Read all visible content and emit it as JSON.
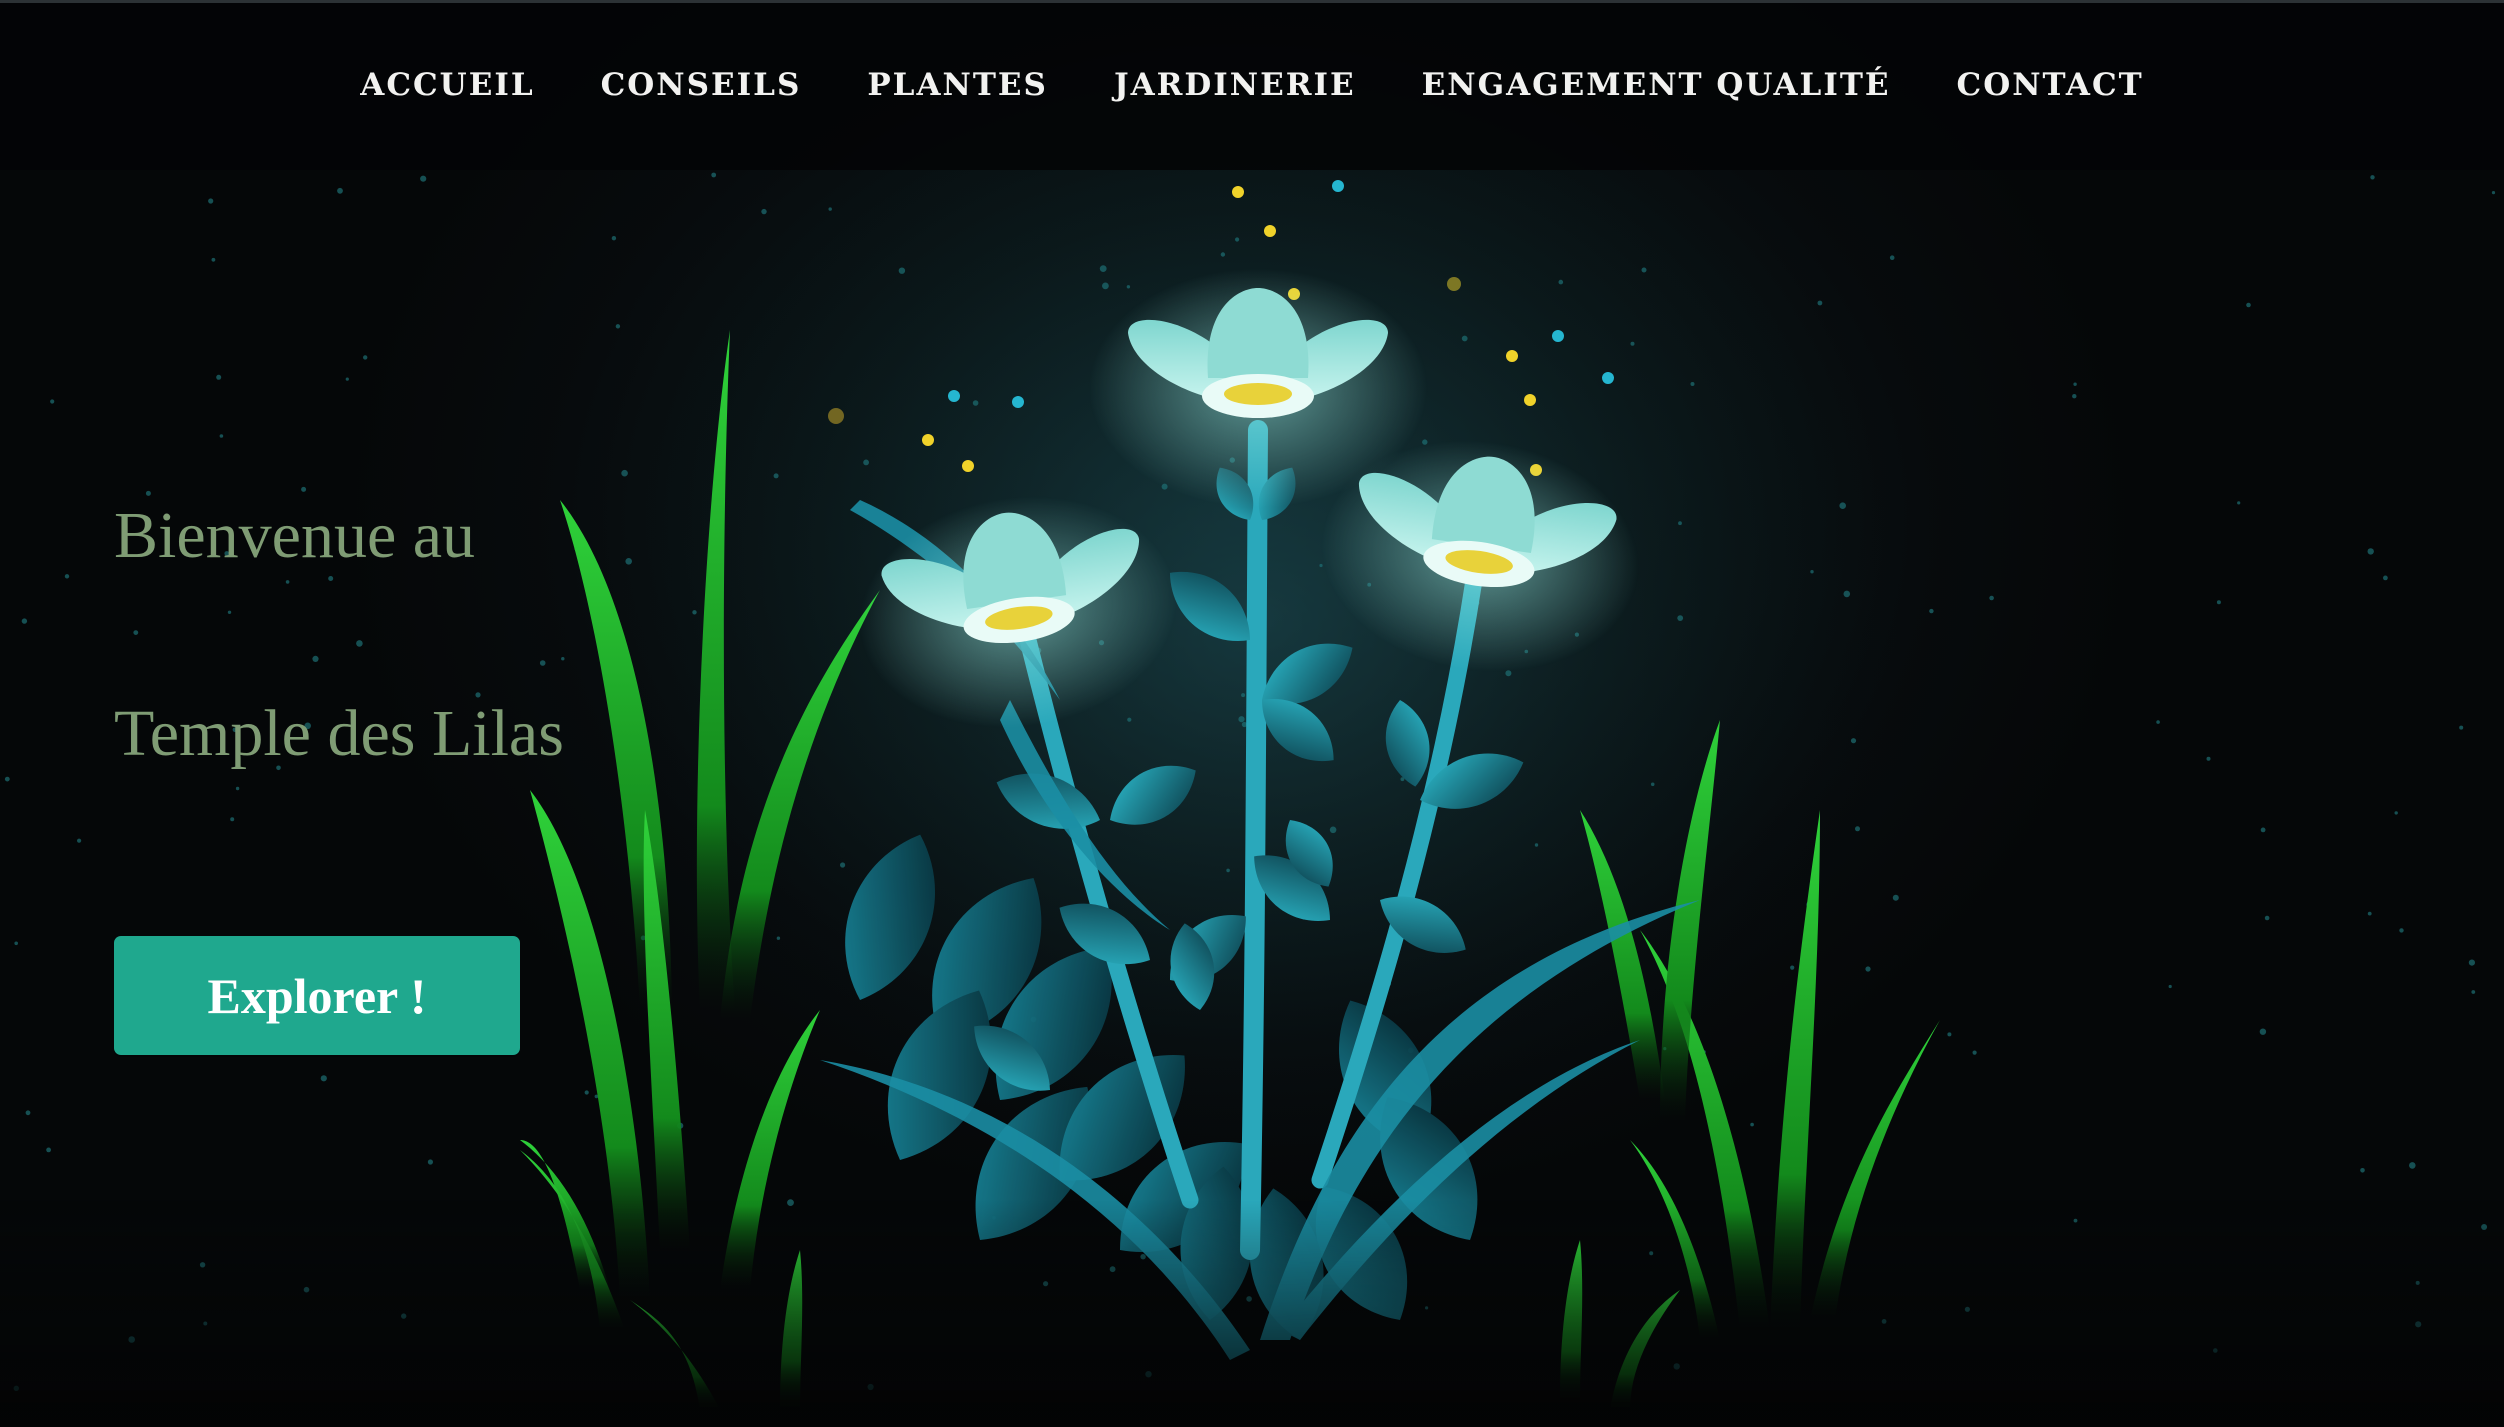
{
  "nav": {
    "items": [
      {
        "label": "ACCUEIL"
      },
      {
        "label": "CONSEILS"
      },
      {
        "label": "PLANTES"
      },
      {
        "label": "JARDINERIE"
      },
      {
        "label": "ENGAGEMENT QUALITÉ"
      },
      {
        "label": "CONTACT"
      }
    ]
  },
  "hero": {
    "title_line_1": "Bienvenue au",
    "title_line_2": "Temple des Lilas",
    "cta_label": "Explorer !"
  },
  "colors": {
    "background": "#070b0d",
    "nav_background": "#030506",
    "title_text": "#7f9c74",
    "button": "#1fa88e",
    "flower_glow": "#8fe8de",
    "leaf": "#1d8ca0",
    "grass": "#24b02a",
    "firefly_yellow": "#f0d22a",
    "firefly_cyan": "#25b6d0"
  },
  "illustration": {
    "subject": "glowing-flowers-illustration",
    "icons": [
      "flower-icon",
      "leaf-icon",
      "grass-blade-icon",
      "firefly-icon",
      "star-dot-icon"
    ]
  }
}
